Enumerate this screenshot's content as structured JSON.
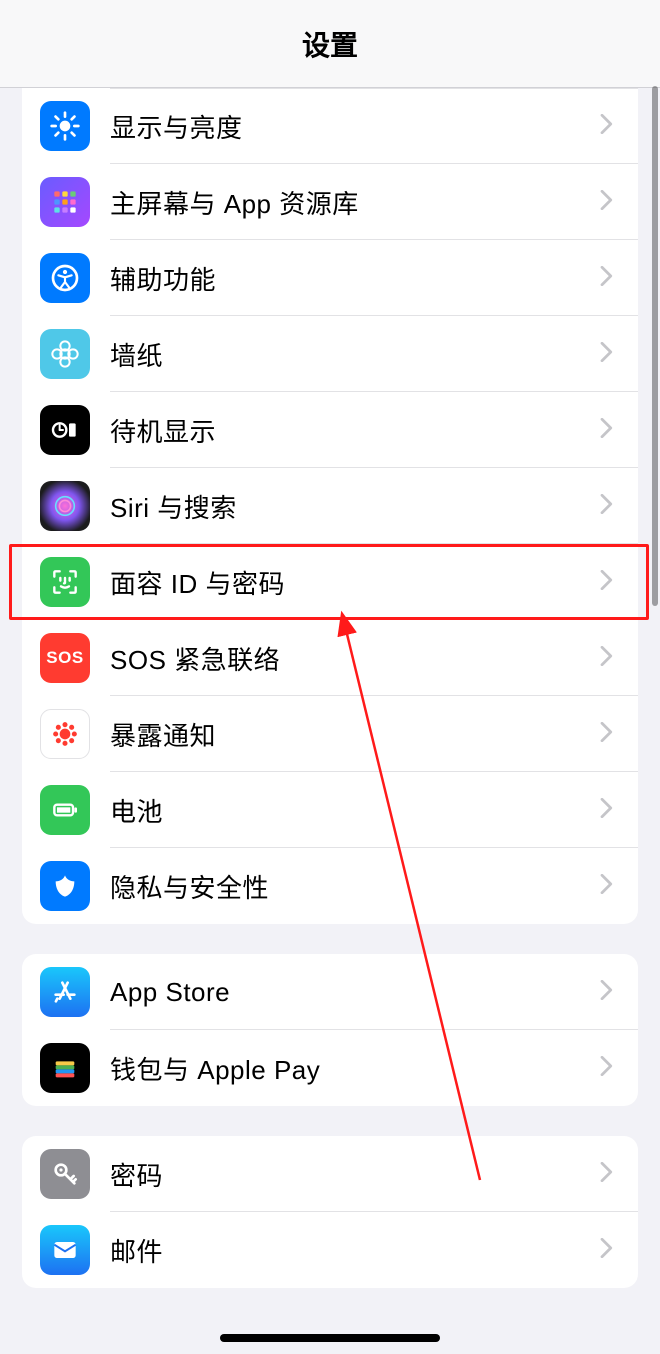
{
  "header": {
    "title": "设置"
  },
  "groups": [
    {
      "id": "g1",
      "rows": [
        {
          "id": "display",
          "label": "显示与亮度"
        },
        {
          "id": "homescreen",
          "label": "主屏幕与 App 资源库"
        },
        {
          "id": "accessibility",
          "label": "辅助功能"
        },
        {
          "id": "wallpaper",
          "label": "墙纸"
        },
        {
          "id": "standby",
          "label": "待机显示"
        },
        {
          "id": "siri",
          "label": "Siri 与搜索"
        },
        {
          "id": "faceid",
          "label": "面容 ID 与密码",
          "highlighted": true
        },
        {
          "id": "sos",
          "label": "SOS 紧急联络"
        },
        {
          "id": "exposure",
          "label": "暴露通知"
        },
        {
          "id": "battery",
          "label": "电池"
        },
        {
          "id": "privacy",
          "label": "隐私与安全性"
        }
      ]
    },
    {
      "id": "g2",
      "rows": [
        {
          "id": "appstore",
          "label": "App Store"
        },
        {
          "id": "wallet",
          "label": "钱包与 Apple Pay"
        }
      ]
    },
    {
      "id": "g3",
      "rows": [
        {
          "id": "passwords",
          "label": "密码"
        },
        {
          "id": "mail",
          "label": "邮件"
        }
      ]
    }
  ],
  "annotation": {
    "highlight_target": "faceid",
    "arrow": true
  }
}
